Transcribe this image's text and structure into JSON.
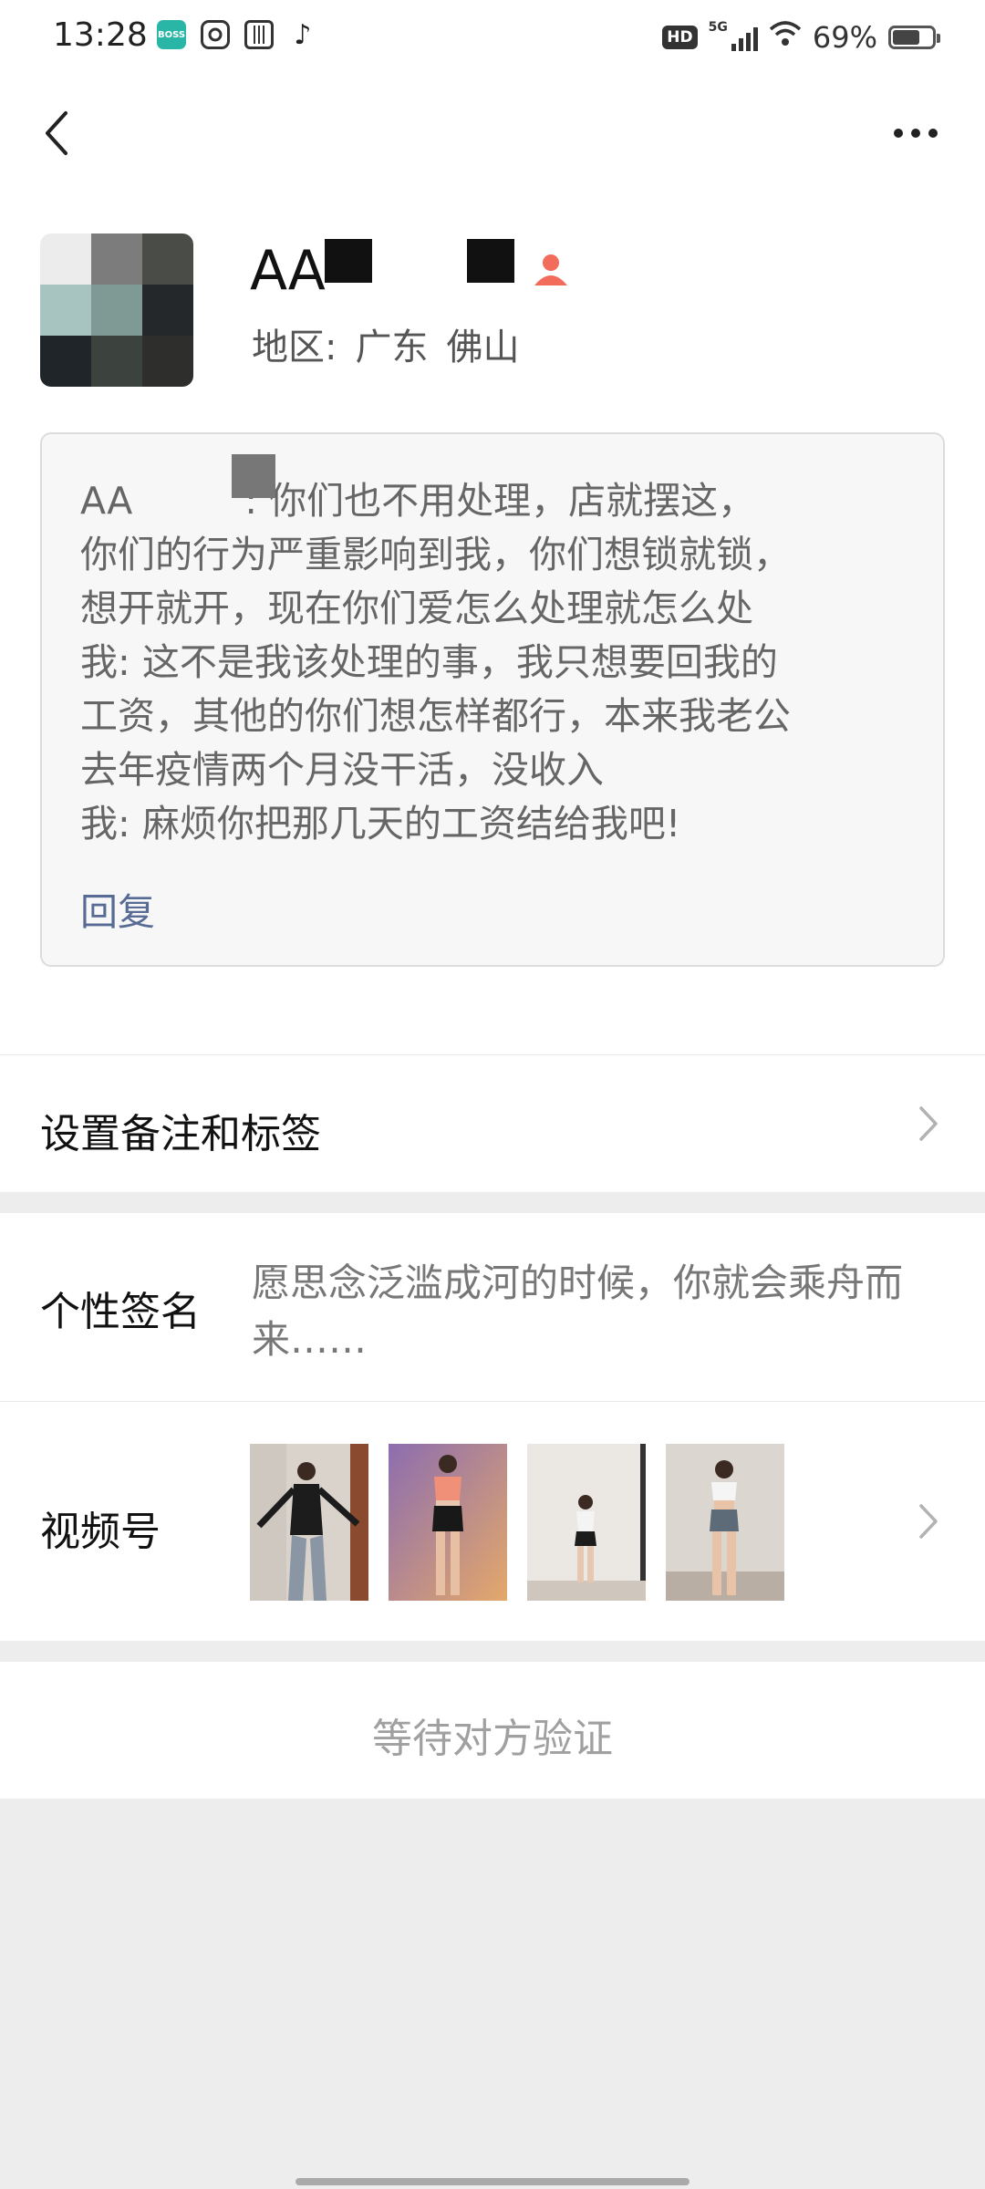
{
  "status_bar": {
    "time": "13:28",
    "app_icons": [
      "boss-zhipin-icon",
      "instagram-icon",
      "news-icon",
      "tiktok-icon"
    ],
    "hd_label": "HD",
    "network": "5G",
    "battery_percent": "69%",
    "battery_level": 0.69
  },
  "header": {
    "back_icon": "chevron-left-icon",
    "more_icon": "more-dots-icon"
  },
  "profile": {
    "name_visible": "AA",
    "gender_icon": "female-icon",
    "region_label": "地区:",
    "region_province": "广东",
    "region_city": "佛山"
  },
  "messages": {
    "lines": [
      "AA　　　: 你们也不用处理，店就摆这，",
      "你们的行为严重影响到我，你们想锁就锁，",
      "想开就开，现在你们爱怎么处理就怎么处",
      "我: 这不是我该处理的事，我只想要回我的",
      "工资，其他的你们想怎样都行，本来我老公",
      "去年疫情两个月没干活，没收入",
      "我: 麻烦你把那几天的工资结给我吧!"
    ],
    "reply_label": "回复"
  },
  "remark_cell": {
    "label": "设置备注和标签"
  },
  "signature_cell": {
    "label": "个性签名",
    "text": "愿思念泛滥成河的时候，你就会乘舟而来……"
  },
  "video_cell": {
    "label": "视频号"
  },
  "action": {
    "label": "等待对方验证"
  },
  "colors": {
    "link": "#576b95",
    "background": "#ededed",
    "female_badge": "#f26b5b"
  }
}
